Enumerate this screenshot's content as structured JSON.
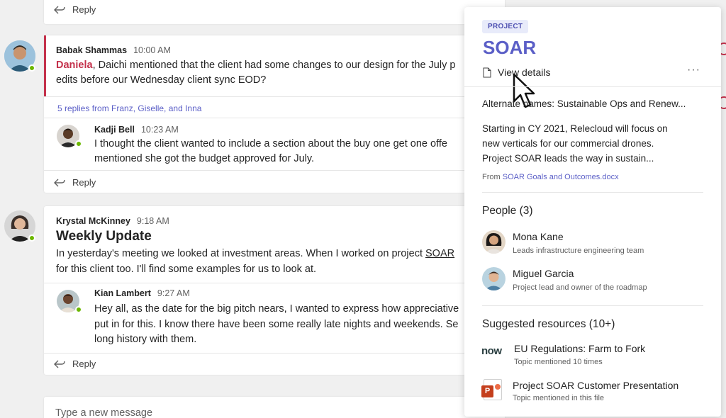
{
  "colors": {
    "background": "#f0f0f0",
    "accent": "#5b5fc7",
    "mention": "#c4314b",
    "presence": "#6bb700"
  },
  "thread_top": {
    "reply_label": "Reply"
  },
  "thread1": {
    "sender": "Babak Shammas",
    "time": "10:00 AM",
    "mention": "Daniela",
    "text_line1": ", Daichi mentioned that the client had some changes to our design for the July p",
    "text_line2": "edits before our Wednesday client sync EOD?",
    "replies_summary": "5 replies from Franz, Giselle, and Inna",
    "reply": {
      "sender": "Kadji Bell",
      "time": "10:23 AM",
      "text_line1": "I thought the client wanted to include a section about the buy one get one offe",
      "text_line2": "mentioned she got the budget approved for July."
    },
    "reply_label": "Reply"
  },
  "thread2": {
    "sender": "Krystal McKinney",
    "time": "9:18 AM",
    "subject": "Weekly Update",
    "text_line1_before": "In yesterday's meeting we looked at investment areas. When I worked on project ",
    "text_line1_link": "SOAR",
    "text_line2": "for this client too. I'll find some examples for us to look at.",
    "reply": {
      "sender": "Kian Lambert",
      "time": "9:27 AM",
      "text_line1": "Hey all, as the date for the big pitch nears, I wanted to express how appreciative",
      "text_line2": "put in for this. I know there have been some really late nights and weekends. Se",
      "text_line3": "long history with them."
    },
    "reply_label": "Reply"
  },
  "compose": {
    "placeholder": "Type a new message"
  },
  "panel": {
    "tag": "PROJECT",
    "title": "SOAR",
    "view_details": "View details",
    "more": "···",
    "alternate_names": "Alternate names: Sustainable Ops and Renew...",
    "description_line1": "Starting in CY 2021, Relecloud will focus on",
    "description_line2": "new verticals for our commercial drones.",
    "description_line3": "Project SOAR leads the way in sustain...",
    "from_label": "From ",
    "from_source": "SOAR Goals and Outcomes.docx",
    "people_heading": "People (3)",
    "people": [
      {
        "name": "Mona Kane",
        "role": "Leads infrastructure engineering team"
      },
      {
        "name": "Miguel Garcia",
        "role": "Project lead and owner of the roadmap"
      }
    ],
    "resources_heading": "Suggested resources (10+)",
    "resources": [
      {
        "logo_text": "now",
        "title": "EU Regulations: Farm to Fork",
        "subtitle": "Topic mentioned 10 times",
        "icon": "servicenow-icon"
      },
      {
        "logo_text": "P",
        "title": "Project SOAR Customer Presentation",
        "subtitle": "Topic mentioned in this file",
        "icon": "powerpoint-icon"
      }
    ]
  }
}
